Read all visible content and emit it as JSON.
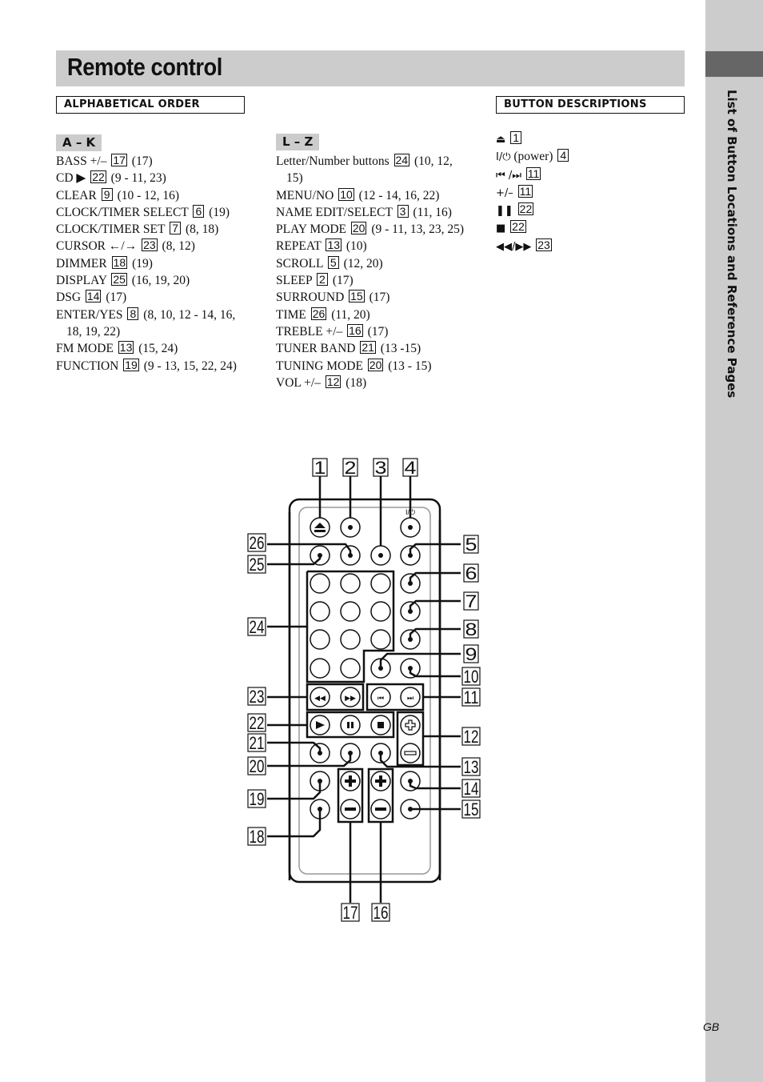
{
  "header": {
    "title": "Remote control"
  },
  "sections": {
    "alphabetical": "ALPHABETICAL ORDER",
    "descriptions": "BUTTON DESCRIPTIONS"
  },
  "ranges": {
    "a_k": "A – K",
    "l_z": "L – Z"
  },
  "a_k": [
    {
      "label": "BASS +/–",
      "num": "17",
      "pages": "(17)"
    },
    {
      "label": "CD ▶",
      "num": "22",
      "pages": "(9 - 11, 23)"
    },
    {
      "label": "CLEAR",
      "num": "9",
      "pages": "(10 - 12, 16)"
    },
    {
      "label": "CLOCK/TIMER SELECT",
      "num": "6",
      "pages": "(19)"
    },
    {
      "label": "CLOCK/TIMER SET",
      "num": "7",
      "pages": "(8, 18)"
    },
    {
      "label": "CURSOR ←/→",
      "num": "23",
      "pages": "(8, 12)"
    },
    {
      "label": "DIMMER",
      "num": "18",
      "pages": "(19)"
    },
    {
      "label": "DISPLAY",
      "num": "25",
      "pages": "(16, 19, 20)"
    },
    {
      "label": "DSG",
      "num": "14",
      "pages": "(17)"
    },
    {
      "label": "ENTER/YES",
      "num": "8",
      "pages": "(8, 10, 12 - 14, 16, 18, 19, 22)"
    },
    {
      "label": "FM MODE",
      "num": "13",
      "pages": "(15, 24)"
    },
    {
      "label": "FUNCTION",
      "num": "19",
      "pages": "(9 - 13, 15, 22, 24)"
    }
  ],
  "l_z": [
    {
      "label": "Letter/Number buttons",
      "num": "24",
      "pages": "(10, 12, 15)"
    },
    {
      "label": "MENU/NO",
      "num": "10",
      "pages": "(12 - 14, 16, 22)"
    },
    {
      "label": "NAME EDIT/SELECT",
      "num": "3",
      "pages": "(11, 16)"
    },
    {
      "label": "PLAY MODE",
      "num": "20",
      "pages": "(9 - 11, 13, 23, 25)"
    },
    {
      "label": "REPEAT",
      "num": "13",
      "pages": "(10)"
    },
    {
      "label": "SCROLL",
      "num": "5",
      "pages": "(12, 20)"
    },
    {
      "label": "SLEEP",
      "num": "2",
      "pages": "(17)"
    },
    {
      "label": "SURROUND",
      "num": "15",
      "pages": "(17)"
    },
    {
      "label": "TIME",
      "num": "26",
      "pages": "(11, 20)"
    },
    {
      "label": "TREBLE +/–",
      "num": "16",
      "pages": "(17)"
    },
    {
      "label": "TUNER BAND",
      "num": "21",
      "pages": "(13 -15)"
    },
    {
      "label": "TUNING MODE",
      "num": "20",
      "pages": "(13 - 15)"
    },
    {
      "label": "VOL +/–",
      "num": "12",
      "pages": "(18)"
    }
  ],
  "descriptions": [
    {
      "symbol": "⏏",
      "text": "",
      "num": "1"
    },
    {
      "symbol": "I/⏻",
      "text": "(power)",
      "num": "4"
    },
    {
      "symbol": "⏮ /⏭",
      "text": "",
      "num": "11"
    },
    {
      "symbol": "+/–",
      "text": "",
      "num": "11"
    },
    {
      "symbol": "❚❚",
      "text": "",
      "num": "22"
    },
    {
      "symbol": "■",
      "text": "",
      "num": "22"
    },
    {
      "symbol": "◀◀/▶▶",
      "text": "",
      "num": "23"
    }
  ],
  "sidebar": {
    "text": "List of Button Locations and Reference Pages"
  },
  "footer": {
    "region": "GB"
  },
  "remote": {
    "power_label": "I/⏻",
    "callouts": [
      "1",
      "2",
      "3",
      "4",
      "5",
      "6",
      "7",
      "8",
      "9",
      "10",
      "11",
      "12",
      "13",
      "14",
      "15",
      "16",
      "17",
      "18",
      "19",
      "20",
      "21",
      "22",
      "23",
      "24",
      "25",
      "26"
    ]
  }
}
